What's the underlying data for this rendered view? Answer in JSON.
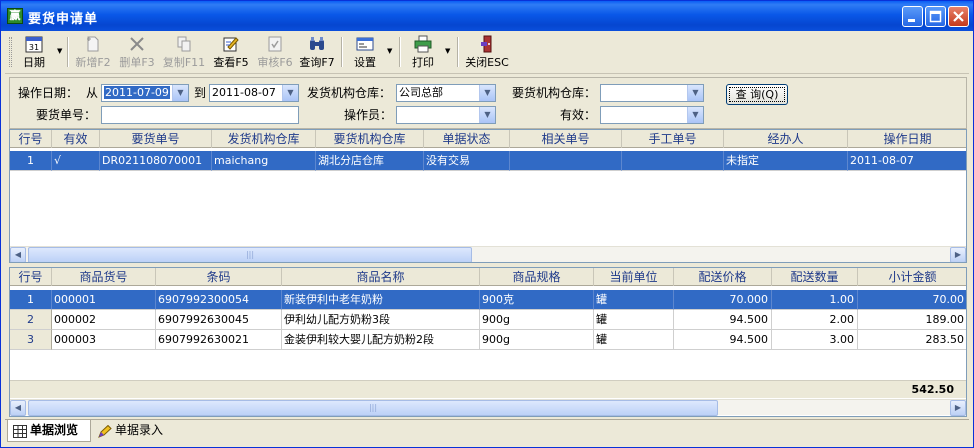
{
  "window": {
    "title": "要货申请单",
    "app_icon_char": "赢"
  },
  "toolbar": {
    "date_label": "日期",
    "date_icon_number": "31",
    "new_label": "新增F2",
    "delete_label": "删单F3",
    "copy_label": "复制F11",
    "view_label": "查看F5",
    "audit_label": "审核F6",
    "query_label": "查询F7",
    "settings_label": "设置",
    "print_label": "打印",
    "close_label": "关闭ESC"
  },
  "filters": {
    "op_date_label": "操作日期：",
    "from_label": "从",
    "from_value": "2011-07-09",
    "to_label": "到",
    "to_value": "2011-08-07",
    "send_wh_label": "发货机构仓库：",
    "send_wh_value": "公司总部",
    "req_wh_label": "要货机构仓库：",
    "req_wh_value": "",
    "req_no_label": "要货单号：",
    "req_no_value": "",
    "operator_label": "操作员：",
    "operator_value": "",
    "valid_label": "有效：",
    "valid_value": "",
    "query_button": "查 询(Q)"
  },
  "order_grid": {
    "columns": [
      "行号",
      "有效",
      "要货单号",
      "发货机构仓库",
      "要货机构仓库",
      "单据状态",
      "相关单号",
      "手工单号",
      "经办人",
      "操作日期"
    ],
    "rows": [
      {
        "line": "1",
        "valid": "√",
        "order_no": "DR021108070001",
        "send_wh": "maichang",
        "req_wh": "湖北分店仓库",
        "status": "没有交易",
        "related_no": "",
        "manual_no": "",
        "handler": "未指定",
        "date": "2011-08-07"
      }
    ]
  },
  "detail_grid": {
    "columns": [
      "行号",
      "商品货号",
      "条码",
      "商品名称",
      "商品规格",
      "当前单位",
      "配送价格",
      "配送数量",
      "小计金额"
    ],
    "rows": [
      {
        "line": "1",
        "sku": "000001",
        "barcode": "6907992300054",
        "name": "新装伊利中老年奶粉",
        "spec": "900克",
        "unit": "罐",
        "price": "70.000",
        "qty": "1.00",
        "subtotal": "70.00"
      },
      {
        "line": "2",
        "sku": "000002",
        "barcode": "6907992630045",
        "name": "伊利幼儿配方奶粉3段",
        "spec": "900g",
        "unit": "罐",
        "price": "94.500",
        "qty": "2.00",
        "subtotal": "189.00"
      },
      {
        "line": "3",
        "sku": "000003",
        "barcode": "6907992630021",
        "name": "金装伊利较大婴儿配方奶粉2段",
        "spec": "900g",
        "unit": "罐",
        "price": "94.500",
        "qty": "3.00",
        "subtotal": "283.50"
      }
    ],
    "total": "542.50"
  },
  "tabs": {
    "browse_label": "单据浏览",
    "entry_label": "单据录入"
  },
  "colors": {
    "title_bar": "#0a58e8",
    "selection": "#316ac5",
    "header_text": "#1f3a8a",
    "window_bg": "#ece9d8"
  }
}
